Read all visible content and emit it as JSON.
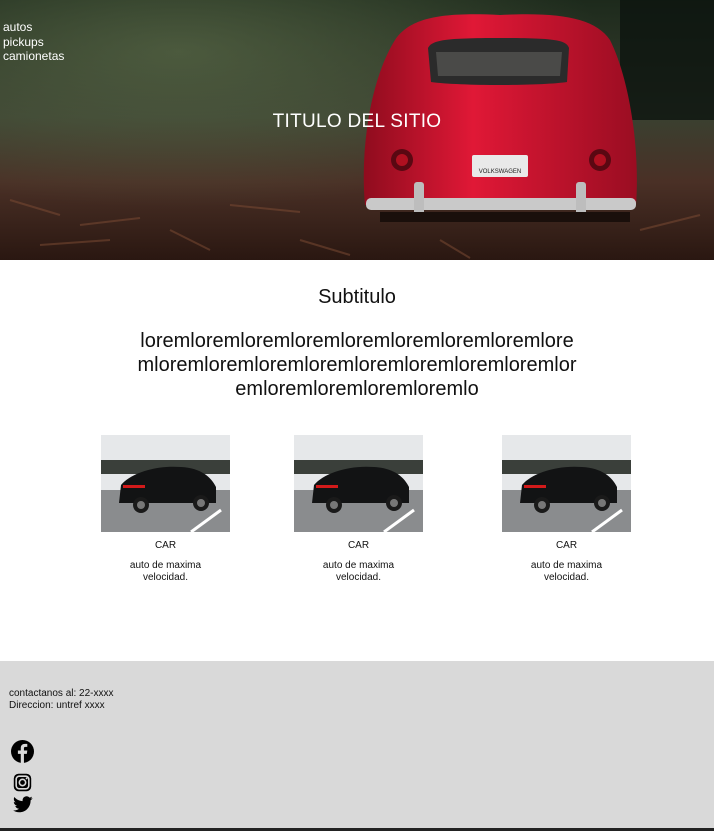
{
  "nav": {
    "items": [
      "autos",
      "pickups",
      "camionetas"
    ]
  },
  "hero": {
    "title": "TITULO DEL SITIO",
    "plate_text": "VOLKSWAGEN"
  },
  "main": {
    "subtitle": "Subtitulo",
    "paragraph": "loremloremloremloremloremloremloremloremloremloremloremloremloremloremloremloremloremloremloremloremloremloremlo"
  },
  "cards": [
    {
      "name": "CAR",
      "description": "auto de maxima velocidad."
    },
    {
      "name": "CAR",
      "description": "auto de maxima velocidad."
    },
    {
      "name": "CAR",
      "description": "auto de maxima velocidad."
    }
  ],
  "footer": {
    "contact_line": "contactanos al: 22-xxxx",
    "address_line": "Direccion: untref xxxx",
    "social_icons": [
      "facebook-icon",
      "instagram-icon",
      "twitter-icon"
    ]
  },
  "colors": {
    "car_red": "#c8102e",
    "footer_bg": "#d9d9d9"
  }
}
